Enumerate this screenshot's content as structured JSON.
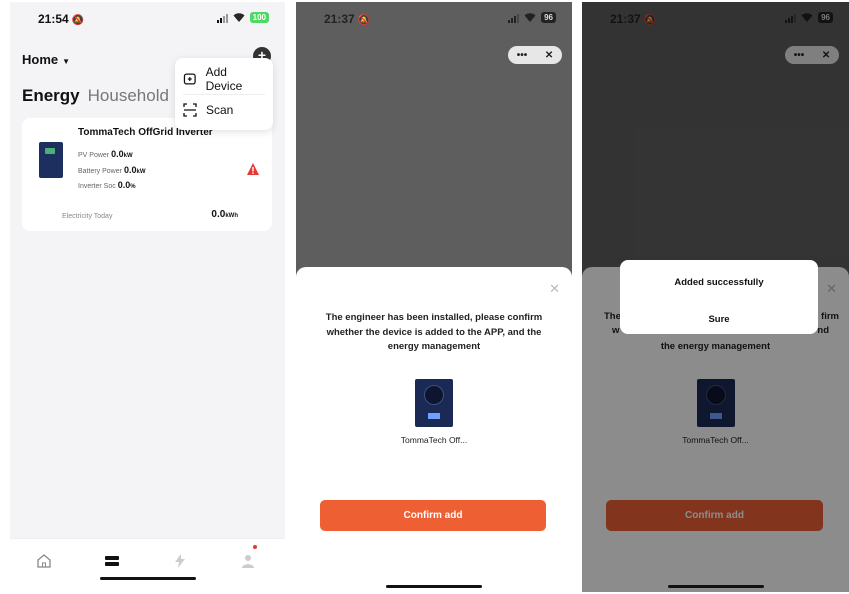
{
  "screen1": {
    "status": {
      "time": "21:54",
      "battery": "100"
    },
    "header": {
      "title": "Home"
    },
    "tabs": {
      "active": "Energy",
      "other": "Household"
    },
    "menu": {
      "items": [
        {
          "label": "Add Device",
          "icon": "add-device-icon"
        },
        {
          "label": "Scan",
          "icon": "scan-icon"
        }
      ]
    },
    "card": {
      "title": "TommaTech OffGrid Inverter",
      "pv_label": "PV Power",
      "pv_value": "0.0",
      "pv_unit": "kW",
      "battery_label": "Battery Power",
      "battery_value": "0.0",
      "battery_unit": "kW",
      "soc_label": "Inverter Soc",
      "soc_value": "0.0",
      "soc_unit": "%",
      "electricity_label": "Electricity Today",
      "electricity_value": "0.0",
      "electricity_unit": "kWh"
    },
    "tabbar": {
      "items": [
        "home-icon",
        "device-icon",
        "energy-icon",
        "profile-icon"
      ]
    }
  },
  "screen2": {
    "status": {
      "time": "21:37",
      "battery": "96"
    },
    "sheet": {
      "message": "The engineer has been installed, please confirm whether the device is added to the APP, and the energy management",
      "device_name": "TommaTech Off...",
      "confirm_label": "Confirm add"
    }
  },
  "screen3": {
    "status": {
      "time": "21:37",
      "battery": "96"
    },
    "sheet": {
      "fragment_left": "The",
      "fragment_left2": "w",
      "fragment_right": "firm",
      "fragment_right2": "nd",
      "message_tail": "the energy management",
      "device_name": "TommaTech Off...",
      "confirm_label": "Confirm add"
    },
    "dialog": {
      "title": "Added successfully",
      "button": "Sure"
    }
  },
  "colors": {
    "accent": "#ef5f34",
    "warning": "#e53935",
    "battery_green": "#4cd964"
  }
}
